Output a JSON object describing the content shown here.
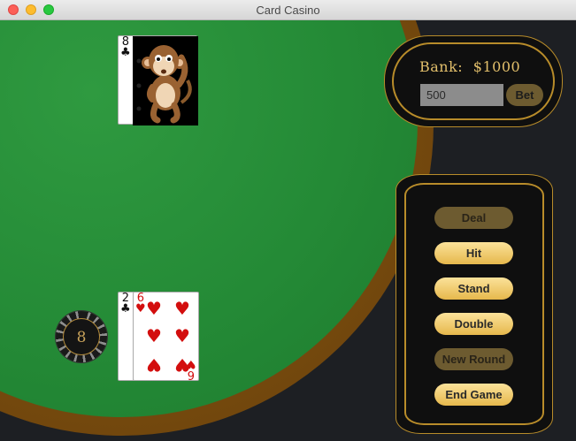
{
  "window": {
    "title": "Card Casino"
  },
  "dealer_hand": {
    "up_card": {
      "rank": "8",
      "suit": "♣"
    },
    "hole_card_image": "monkey-card-back"
  },
  "player_hand": {
    "cards": [
      {
        "rank": "2",
        "suit": "♣"
      },
      {
        "rank": "6",
        "suit": "♥"
      }
    ]
  },
  "chip": {
    "value": "8"
  },
  "bank": {
    "label": "Bank:",
    "amount": "$1000"
  },
  "bet": {
    "value": "500",
    "button_label": "Bet"
  },
  "controls": {
    "deal": "Deal",
    "hit": "Hit",
    "stand": "Stand",
    "double": "Double",
    "new_round": "New Round",
    "end_game": "End Game"
  },
  "colors": {
    "felt": "#248a36",
    "rim": "#7a4c0e",
    "gold": "#b88c2a",
    "button": "#f2cc6d"
  }
}
